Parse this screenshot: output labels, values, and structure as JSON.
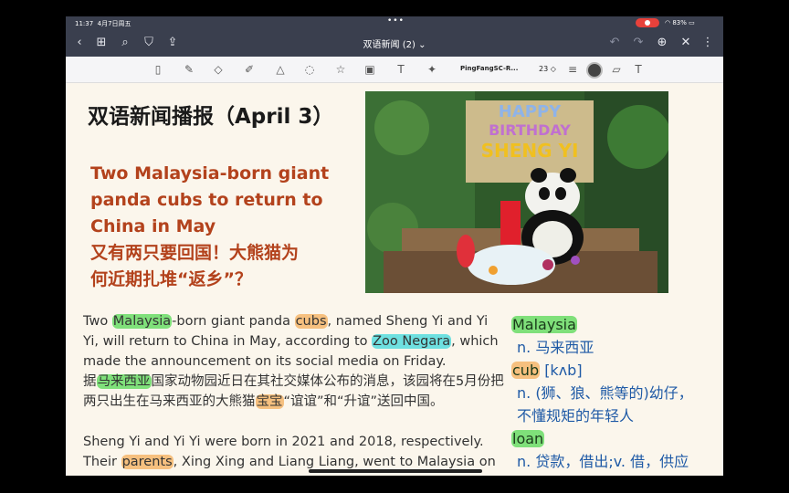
{
  "status": {
    "time": "11:37",
    "date": "4月7日周五",
    "battery": "83%"
  },
  "nav": {
    "title": "双语新闻 (2) ⌄"
  },
  "toolbar": {
    "font_name": "PingFangSC-R...",
    "font_size": "23 ◇"
  },
  "page": {
    "title": "双语新闻播报（April 3）",
    "headline_lines": [
      "Two Malaysia-born giant",
      "panda cubs to return to",
      "China in May",
      "又有两只要回国！大熊猫为",
      "何近期扎堆“返乡”？"
    ],
    "photo": {
      "banner_line1": "HAPPY",
      "banner_line2": "BIRTHDAY",
      "banner_line3": "SHENG YI"
    },
    "para1": {
      "t1": "Two ",
      "malaysia": "Malaysia",
      "t2": "-born giant panda ",
      "cubs": "cubs",
      "t3": ", named Sheng Yi and Yi Yi, will return to China in May, according to ",
      "zoo": "Zoo Negara",
      "t4": ", which made the announcement on its social media on Friday."
    },
    "para1_cn": {
      "t1": "据",
      "malaysia": "马来西亚",
      "t2": "国家动物园近日在其社交媒体公布的消息，该园将在5月份把两只出生在马来西亚的大熊猫",
      "baobao": "宝宝",
      "t3": "“谊谊”和“升谊”送回中国。"
    },
    "para2": {
      "t1": "Sheng Yi and Yi Yi were born in 2021 and 2018, respectively. Their ",
      "parents": "parents",
      "t2": ", Xing Xing and Liang Liang, went to Malaysia on"
    }
  },
  "vocab": [
    {
      "word": "Malaysia",
      "meaning": "n. 马来西亚",
      "color": "#7fe07a"
    },
    {
      "word": "cub",
      "phonetic": "[kʌb]",
      "meaning": "n. (狮、狼、熊等的)幼仔，",
      "meaning2": "不懂规矩的年轻人",
      "color": "#f6c07f"
    },
    {
      "word": "loan",
      "meaning": "n. 贷款，借出;v. 借，供应",
      "color": "#7fe07a"
    }
  ]
}
